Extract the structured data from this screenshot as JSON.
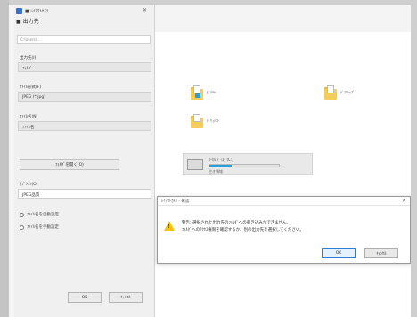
{
  "window": {
    "app_title": "■ ﾚｲｱｳﾄｶﾒﾗ",
    "subtitle": "■ 出力先",
    "path_placeholder": "C:\\Users\\..."
  },
  "left_panel": {
    "fields": [
      {
        "label": "出力先(I)",
        "value": "ﾌｫﾙﾀﾞ"
      },
      {
        "label": "ﾌｧｲﾙ形式(F)",
        "value": "JPEG (*.jpg)"
      },
      {
        "label": "ﾌｧｲﾙ名(N)",
        "value": "ﾌｧｲﾙ名"
      }
    ],
    "action_button": "ﾌｫﾙﾀﾞを開く(O)",
    "option_label": "ｵﾌﾟｼｮﾝ(O)",
    "option_value": "JPEG品質",
    "radios": [
      "ﾌｧｲﾙ名を自動設定",
      "ﾌｧｲﾙ名を手動設定"
    ],
    "ok_button": "OK",
    "cancel_button": "ｷｬﾝｾﾙ"
  },
  "explorer": {
    "items": [
      {
        "label": "ﾋﾟｸﾁｬ"
      },
      {
        "label": "ﾄﾞｷｭﾒﾝﾄ"
      },
      {
        "label": "ﾃﾞｽｸﾄｯﾌﾟ"
      }
    ],
    "drive": {
      "label": "ﾛｰｶﾙ ﾃﾞｨｽｸ (C:)",
      "used_fraction": 0.32,
      "space_text": "空き領域"
    }
  },
  "dialog": {
    "title": "ﾚｲｱｳﾄｶﾒﾗ - 確認",
    "line1": "警告: 選択された出力先のﾌｫﾙﾀﾞへの書き込みができません。",
    "line2": "ﾌｫﾙﾀﾞへのｱｸｾｽ権限を確認するか、別の出力先を選択してください。",
    "ok_button": "OK",
    "cancel_button": "ｷｬﾝｾﾙ"
  },
  "colors": {
    "accent": "#26a0da",
    "warning": "#f1c40f",
    "folder": "#f3cd5b"
  }
}
